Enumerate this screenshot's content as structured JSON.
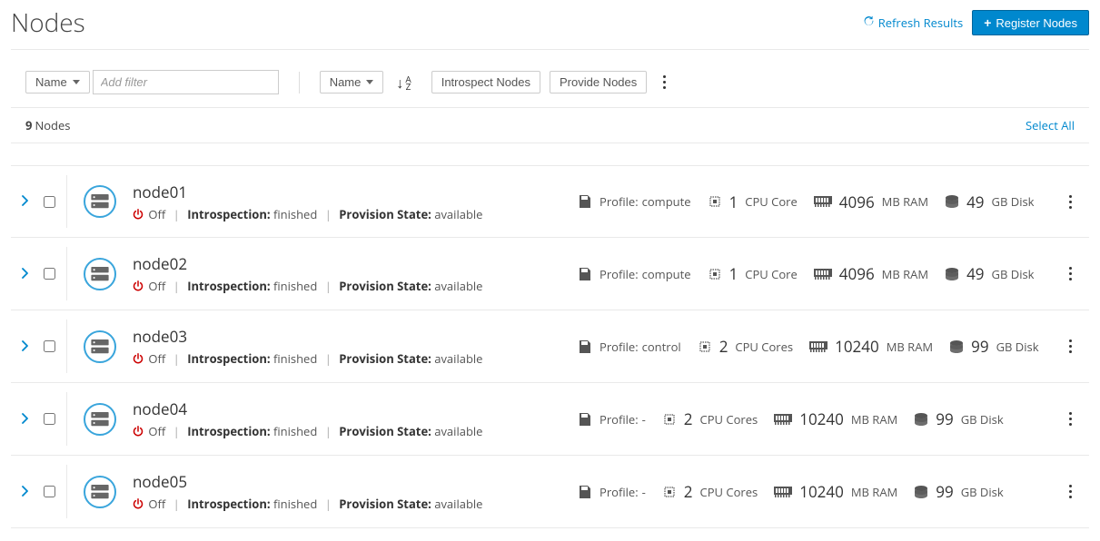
{
  "page": {
    "title": "Nodes"
  },
  "header": {
    "refresh_label": "Refresh Results",
    "register_label": "Register Nodes"
  },
  "toolbar": {
    "filter_dropdown_label": "Name",
    "filter_placeholder": "Add filter",
    "sort_dropdown_label": "Name",
    "introspect_label": "Introspect Nodes",
    "provide_label": "Provide Nodes"
  },
  "count": {
    "value": "9",
    "label": "Nodes",
    "select_all": "Select All"
  },
  "labels": {
    "introspection": "Introspection:",
    "provision_state": "Provision State:",
    "profile": "Profile:",
    "cpu_core_singular": "CPU Core",
    "cpu_core_plural": "CPU Cores",
    "mb_ram": "MB RAM",
    "gb_disk": "GB Disk",
    "power_off": "Off"
  },
  "nodes": [
    {
      "name": "node01",
      "power": "Off",
      "introspection": "finished",
      "provision": "available",
      "profile": "compute",
      "cpu": "1",
      "cpu_plural": false,
      "ram": "4096",
      "disk": "49"
    },
    {
      "name": "node02",
      "power": "Off",
      "introspection": "finished",
      "provision": "available",
      "profile": "compute",
      "cpu": "1",
      "cpu_plural": false,
      "ram": "4096",
      "disk": "49"
    },
    {
      "name": "node03",
      "power": "Off",
      "introspection": "finished",
      "provision": "available",
      "profile": "control",
      "cpu": "2",
      "cpu_plural": true,
      "ram": "10240",
      "disk": "99"
    },
    {
      "name": "node04",
      "power": "Off",
      "introspection": "finished",
      "provision": "available",
      "profile": "-",
      "cpu": "2",
      "cpu_plural": true,
      "ram": "10240",
      "disk": "99"
    },
    {
      "name": "node05",
      "power": "Off",
      "introspection": "finished",
      "provision": "available",
      "profile": "-",
      "cpu": "2",
      "cpu_plural": true,
      "ram": "10240",
      "disk": "99"
    }
  ]
}
